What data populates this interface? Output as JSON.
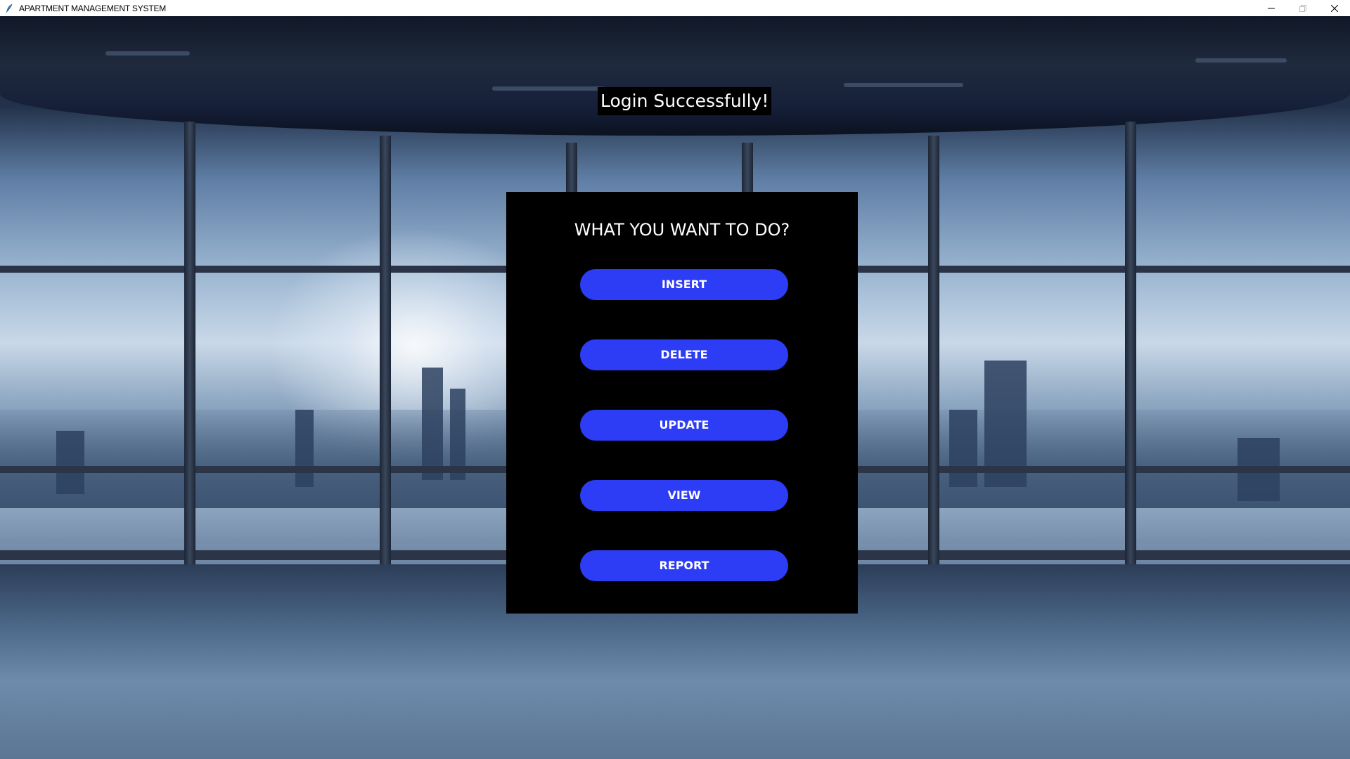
{
  "window": {
    "title": "APARTMENT MANAGEMENT SYSTEM",
    "icon": "feather-icon",
    "controls": [
      "minimize-icon",
      "restore-icon",
      "close-icon"
    ]
  },
  "banner": {
    "text": "Login Successfully!"
  },
  "menu": {
    "title": "WHAT YOU WANT TO DO?",
    "buttons": [
      {
        "label": "INSERT"
      },
      {
        "label": "DELETE"
      },
      {
        "label": "UPDATE"
      },
      {
        "label": "VIEW"
      },
      {
        "label": "REPORT"
      }
    ]
  },
  "colors": {
    "button": "#2d3cf5",
    "panel": "#000000",
    "banner": "#000000",
    "text": "#ffffff"
  }
}
